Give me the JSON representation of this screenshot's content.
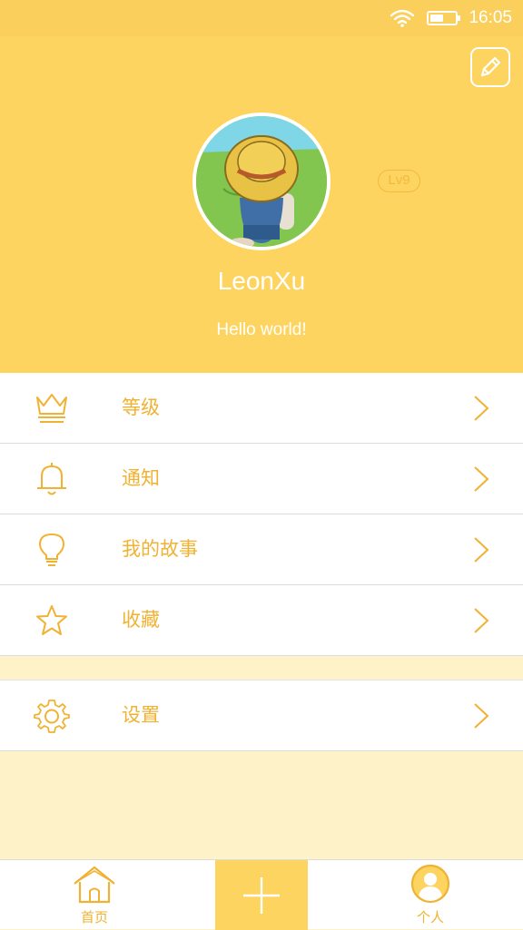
{
  "status_bar": {
    "time": "16:05",
    "battery_level": 0.45
  },
  "profile": {
    "username": "LeonXu",
    "bio": "Hello world!",
    "level": "Lv9"
  },
  "menu": {
    "group1": [
      {
        "label": "等级",
        "icon": "crown-icon"
      },
      {
        "label": "通知",
        "icon": "bell-icon"
      },
      {
        "label": "我的故事",
        "icon": "lightbulb-icon"
      },
      {
        "label": "收藏",
        "icon": "star-icon"
      }
    ],
    "group2": [
      {
        "label": "设置",
        "icon": "gear-icon"
      }
    ]
  },
  "tab_bar": {
    "home_label": "首页",
    "profile_label": "个人"
  },
  "colors": {
    "accent": "#f0b232",
    "header_bg": "#fdd460",
    "status_bg": "#fbcf5c",
    "page_bg": "#fdf2c8"
  }
}
